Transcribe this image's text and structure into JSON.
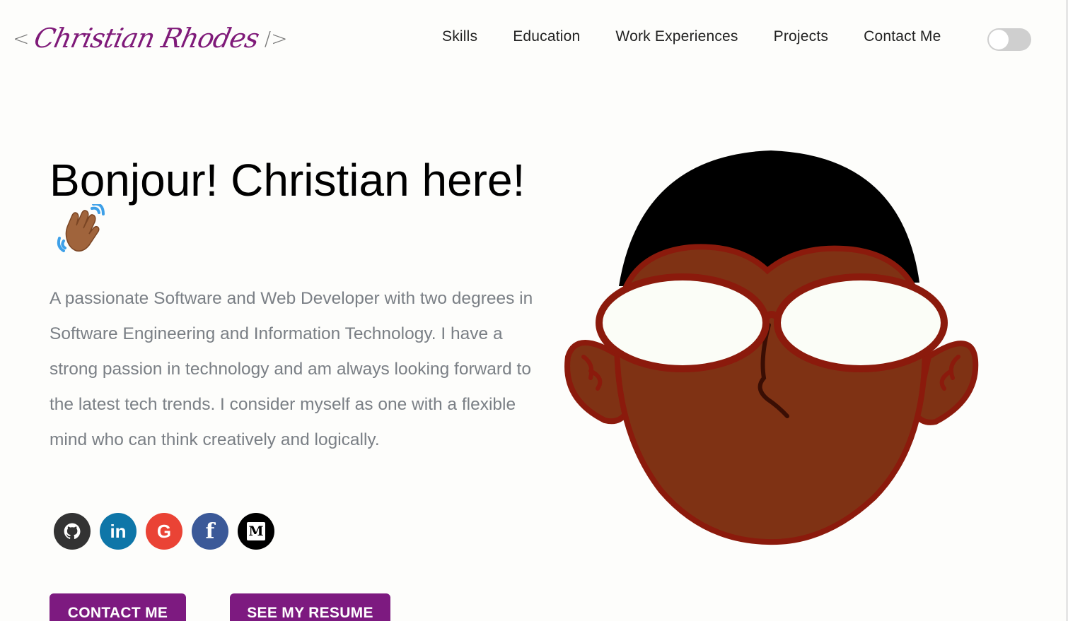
{
  "header": {
    "logo_open": "<",
    "logo_text": "Christian Rhodes",
    "logo_close": "/>",
    "nav": [
      {
        "label": "Skills"
      },
      {
        "label": "Education"
      },
      {
        "label": "Work Experiences"
      },
      {
        "label": "Projects"
      },
      {
        "label": "Contact Me"
      }
    ],
    "theme_toggle": {
      "state": "off"
    }
  },
  "hero": {
    "greeting": "Bonjour! Christian here!",
    "description": "A passionate Software and Web Developer with two degrees in Software Engineering and Information Technology. I have a strong passion in technology and am always looking forward to the latest tech trends. I consider myself as one with a flexible mind who can think creatively and logically.",
    "wave_icon": "waving-hand-icon"
  },
  "socials": [
    {
      "name": "github-icon",
      "glyph": "",
      "color": "#333333"
    },
    {
      "name": "linkedin-icon",
      "glyph": "in",
      "color": "#0e76a8"
    },
    {
      "name": "google-icon",
      "glyph": "G",
      "color": "#ea4335"
    },
    {
      "name": "facebook-icon",
      "glyph": "f",
      "color": "#3b5998"
    },
    {
      "name": "medium-icon",
      "glyph": "M",
      "color": "#000000"
    }
  ],
  "buttons": {
    "contact": "CONTACT ME",
    "resume": "SEE MY RESUME"
  },
  "colors": {
    "accent": "#7d1a80",
    "text_muted": "#7a7f85",
    "skin": "#7f3214",
    "outline": "#8b1a0c",
    "hair": "#000000"
  }
}
